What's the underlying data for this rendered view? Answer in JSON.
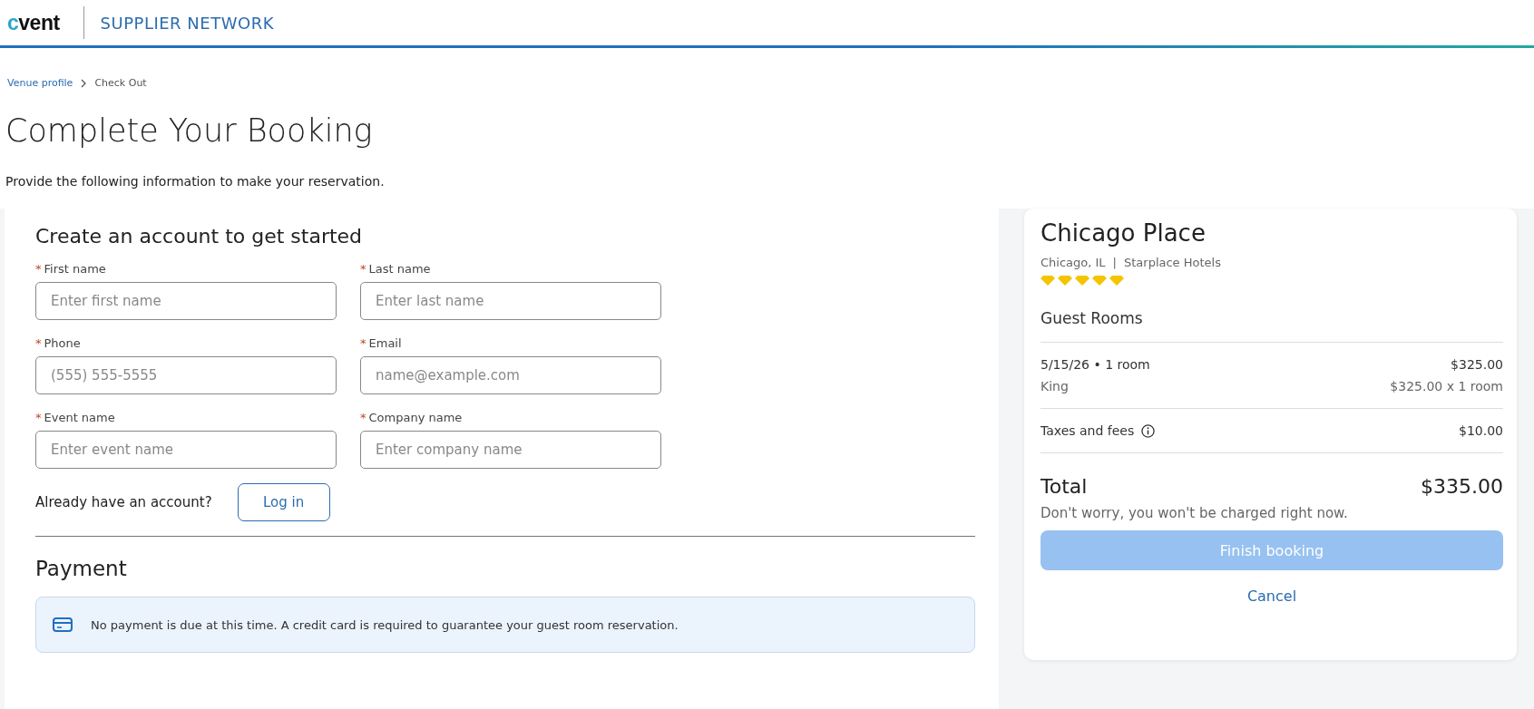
{
  "header": {
    "logo": "cvent",
    "product": "SUPPLIER NETWORK"
  },
  "breadcrumb": [
    {
      "label": "Venue profile",
      "kind": "link"
    },
    {
      "label": "Check Out",
      "kind": "current"
    }
  ],
  "page": {
    "title": "Complete Your Booking",
    "subtitle": "Provide the following information to make your reservation."
  },
  "account": {
    "heading": "Create an account to get started",
    "fields": [
      {
        "required_mark": "*",
        "label": "First name",
        "placeholder": "Enter first name"
      },
      {
        "required_mark": "*",
        "label": "Last name",
        "placeholder": "Enter last name"
      },
      {
        "required_mark": "*",
        "label": "Phone",
        "placeholder": "(555) 555-5555"
      },
      {
        "required_mark": "*",
        "label": "Email",
        "placeholder": "name@example.com"
      },
      {
        "required_mark": "*",
        "label": "Event name",
        "placeholder": "Enter event name"
      },
      {
        "required_mark": "*",
        "label": "Company name",
        "placeholder": "Enter company name"
      }
    ],
    "login_prompt": "Already have an account?",
    "login_button": "Log in"
  },
  "payment": {
    "heading": "Payment",
    "notice": "No payment is due at this time. A credit card is required to guarantee your guest room reservation."
  },
  "summary": {
    "venue": "Chicago Place",
    "city": "Chicago, IL",
    "separator": "|",
    "brand": "Starplace Hotels",
    "stars": 5,
    "section": "Guest Rooms",
    "lines": [
      {
        "label": "5/15/26 • 1 room",
        "amount": "$325.00",
        "kind": "main"
      },
      {
        "label": "King",
        "amount": "$325.00 x 1 room",
        "kind": "sub"
      },
      {
        "label": "Taxes and fees",
        "amount": "$10.00",
        "kind": "info"
      }
    ],
    "total_label": "Total",
    "total": "$335.00",
    "note": "Don't worry, you won't be charged right now.",
    "finish_button": {
      "label": "Finish booking",
      "disabled": true
    },
    "cancel": "Cancel"
  }
}
